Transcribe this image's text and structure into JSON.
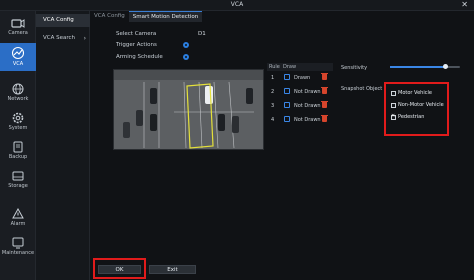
{
  "window": {
    "title": "VCA",
    "close_glyph": "✕"
  },
  "nav": [
    {
      "label": "Camera",
      "icon": "camera-icon",
      "active": false
    },
    {
      "label": "VCA",
      "icon": "vca-icon",
      "active": true
    },
    {
      "label": "Network",
      "icon": "network-icon",
      "active": false
    },
    {
      "label": "System",
      "icon": "system-gear-icon",
      "active": false
    },
    {
      "label": "Backup",
      "icon": "backup-icon",
      "active": false
    },
    {
      "label": "Storage",
      "icon": "storage-icon",
      "active": false
    },
    {
      "label": "Alarm",
      "icon": "alarm-icon",
      "active": false
    },
    {
      "label": "Maintenance",
      "icon": "maintenance-icon",
      "active": false
    }
  ],
  "submenu": [
    {
      "label": "VCA Config",
      "active": true
    },
    {
      "label": "VCA Search",
      "active": false,
      "chevron": "›"
    }
  ],
  "breadcrumbs": [
    "VCA Config",
    "Smart Motion Detection"
  ],
  "form": {
    "select_camera_label": "Select Camera",
    "select_camera_value": "D1",
    "trigger_actions_label": "Trigger Actions",
    "arming_schedule_label": "Arming Schedule"
  },
  "rules": {
    "headers": {
      "rule": "Rule",
      "draw": "Draw"
    },
    "rows": [
      {
        "num": "1",
        "state": "Drawn"
      },
      {
        "num": "2",
        "state": "Not Drawn"
      },
      {
        "num": "3",
        "state": "Not Drawn"
      },
      {
        "num": "4",
        "state": "Not Drawn"
      }
    ]
  },
  "sensitivity": {
    "label": "Sensitivity",
    "value_fraction": 0.78
  },
  "snapshot": {
    "label": "Snapshot Object",
    "options": [
      {
        "label": "Motor Vehicle",
        "checked": false
      },
      {
        "label": "Non-Motor Vehicle",
        "checked": false
      },
      {
        "label": "Pedestrian",
        "checked": true
      }
    ]
  },
  "buttons": {
    "ok": "OK",
    "exit": "Exit"
  },
  "colors": {
    "accent": "#2b6ec6",
    "highlight_box": "#e11b1b",
    "zone_line": "#e4e03a",
    "delete": "#d6452c"
  }
}
